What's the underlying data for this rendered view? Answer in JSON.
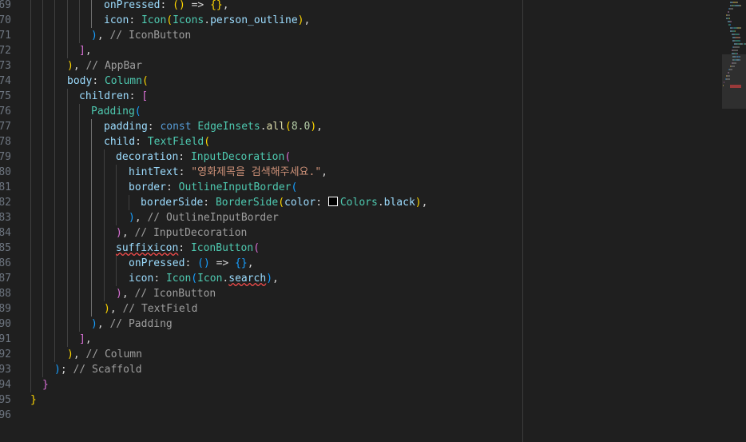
{
  "line_numbers": [
    "69",
    "70",
    "71",
    "72",
    "73",
    "74",
    "75",
    "76",
    "77",
    "78",
    "79",
    "80",
    "81",
    "82",
    "83",
    "84",
    "85",
    "86",
    "87",
    "88",
    "89",
    "90",
    "91",
    "92",
    "93",
    "94",
    "95",
    "96"
  ],
  "code_lines": [
    [
      {
        "t": "onPressed",
        "c": "prop"
      },
      {
        "t": ": ",
        "c": "punc"
      },
      {
        "t": "(",
        "c": "p1"
      },
      {
        "t": ")",
        "c": "p1"
      },
      {
        "t": " => ",
        "c": "punc"
      },
      {
        "t": "{",
        "c": "p1"
      },
      {
        "t": "}",
        "c": "p1"
      },
      {
        "t": ",",
        "c": "punc"
      }
    ],
    [
      {
        "t": "icon",
        "c": "prop"
      },
      {
        "t": ": ",
        "c": "punc"
      },
      {
        "t": "Icon",
        "c": "cls"
      },
      {
        "t": "(",
        "c": "p1"
      },
      {
        "t": "Icons",
        "c": "cls"
      },
      {
        "t": ".",
        "c": "punc"
      },
      {
        "t": "person_outline",
        "c": "prop"
      },
      {
        "t": ")",
        "c": "p1"
      },
      {
        "t": ",",
        "c": "punc"
      }
    ],
    [
      {
        "t": ")",
        "c": "p3"
      },
      {
        "t": ", ",
        "c": "punc"
      },
      {
        "t": "// IconButton",
        "c": "com"
      }
    ],
    [
      {
        "t": "]",
        "c": "p2"
      },
      {
        "t": ",",
        "c": "punc"
      }
    ],
    [
      {
        "t": ")",
        "c": "p1"
      },
      {
        "t": ", ",
        "c": "punc"
      },
      {
        "t": "// AppBar",
        "c": "com"
      }
    ],
    [
      {
        "t": "body",
        "c": "prop"
      },
      {
        "t": ": ",
        "c": "punc"
      },
      {
        "t": "Column",
        "c": "cls"
      },
      {
        "t": "(",
        "c": "p1"
      }
    ],
    [
      {
        "t": "children",
        "c": "prop"
      },
      {
        "t": ": ",
        "c": "punc"
      },
      {
        "t": "[",
        "c": "p2"
      }
    ],
    [
      {
        "t": "Padding",
        "c": "cls"
      },
      {
        "t": "(",
        "c": "p3"
      }
    ],
    [
      {
        "t": "padding",
        "c": "prop"
      },
      {
        "t": ": ",
        "c": "punc"
      },
      {
        "t": "const ",
        "c": "kw"
      },
      {
        "t": "EdgeInsets",
        "c": "cls"
      },
      {
        "t": ".",
        "c": "punc"
      },
      {
        "t": "all",
        "c": "fn"
      },
      {
        "t": "(",
        "c": "p1"
      },
      {
        "t": "8.0",
        "c": "num"
      },
      {
        "t": ")",
        "c": "p1"
      },
      {
        "t": ",",
        "c": "punc"
      }
    ],
    [
      {
        "t": "child",
        "c": "prop"
      },
      {
        "t": ": ",
        "c": "punc"
      },
      {
        "t": "TextField",
        "c": "cls"
      },
      {
        "t": "(",
        "c": "p1"
      }
    ],
    [
      {
        "t": "decoration",
        "c": "prop"
      },
      {
        "t": ": ",
        "c": "punc"
      },
      {
        "t": "InputDecoration",
        "c": "cls"
      },
      {
        "t": "(",
        "c": "p2"
      }
    ],
    [
      {
        "t": "hintText",
        "c": "prop"
      },
      {
        "t": ": ",
        "c": "punc"
      },
      {
        "t": "\"영화제목을 검색해주세요.\"",
        "c": "str"
      },
      {
        "t": ",",
        "c": "punc"
      }
    ],
    [
      {
        "t": "border",
        "c": "prop"
      },
      {
        "t": ": ",
        "c": "punc"
      },
      {
        "t": "OutlineInputBorder",
        "c": "cls"
      },
      {
        "t": "(",
        "c": "p3"
      }
    ],
    [
      {
        "t": "borderSide",
        "c": "prop"
      },
      {
        "t": ": ",
        "c": "punc"
      },
      {
        "t": "BorderSide",
        "c": "cls"
      },
      {
        "t": "(",
        "c": "p1"
      },
      {
        "t": "color",
        "c": "prop"
      },
      {
        "t": ": ",
        "c": "punc"
      },
      {
        "t": "",
        "c": "swatch"
      },
      {
        "t": "Colors",
        "c": "cls"
      },
      {
        "t": ".",
        "c": "punc"
      },
      {
        "t": "black",
        "c": "prop"
      },
      {
        "t": ")",
        "c": "p1"
      },
      {
        "t": ",",
        "c": "punc"
      }
    ],
    [
      {
        "t": ")",
        "c": "p3"
      },
      {
        "t": ", ",
        "c": "punc"
      },
      {
        "t": "// OutlineInputBorder",
        "c": "com"
      }
    ],
    [
      {
        "t": ")",
        "c": "p2"
      },
      {
        "t": ", ",
        "c": "punc"
      },
      {
        "t": "// InputDecoration",
        "c": "com"
      }
    ],
    [
      {
        "t": "suffixicon",
        "c": "prop squig"
      },
      {
        "t": ": ",
        "c": "punc"
      },
      {
        "t": "IconButton",
        "c": "cls"
      },
      {
        "t": "(",
        "c": "p2"
      }
    ],
    [
      {
        "t": "onPressed",
        "c": "prop"
      },
      {
        "t": ": ",
        "c": "punc"
      },
      {
        "t": "(",
        "c": "p3"
      },
      {
        "t": ")",
        "c": "p3"
      },
      {
        "t": " => ",
        "c": "punc"
      },
      {
        "t": "{",
        "c": "p3"
      },
      {
        "t": "}",
        "c": "p3"
      },
      {
        "t": ",",
        "c": "punc"
      }
    ],
    [
      {
        "t": "icon",
        "c": "prop"
      },
      {
        "t": ": ",
        "c": "punc"
      },
      {
        "t": "Icon",
        "c": "cls"
      },
      {
        "t": "(",
        "c": "p3"
      },
      {
        "t": "Icon",
        "c": "cls"
      },
      {
        "t": ".",
        "c": "punc"
      },
      {
        "t": "search",
        "c": "prop squig"
      },
      {
        "t": ")",
        "c": "p3"
      },
      {
        "t": ",",
        "c": "punc"
      }
    ],
    [
      {
        "t": ")",
        "c": "p2"
      },
      {
        "t": ", ",
        "c": "punc"
      },
      {
        "t": "// IconButton",
        "c": "com"
      }
    ],
    [
      {
        "t": ")",
        "c": "p1"
      },
      {
        "t": ", ",
        "c": "punc"
      },
      {
        "t": "// TextField",
        "c": "com"
      }
    ],
    [
      {
        "t": ")",
        "c": "p3"
      },
      {
        "t": ", ",
        "c": "punc"
      },
      {
        "t": "// Padding",
        "c": "com"
      }
    ],
    [
      {
        "t": "]",
        "c": "p2"
      },
      {
        "t": ",",
        "c": "punc"
      }
    ],
    [
      {
        "t": ")",
        "c": "p1"
      },
      {
        "t": ", ",
        "c": "punc"
      },
      {
        "t": "// Column",
        "c": "com"
      }
    ],
    [
      {
        "t": ")",
        "c": "p3"
      },
      {
        "t": "; ",
        "c": "punc"
      },
      {
        "t": "// Scaffold",
        "c": "com"
      }
    ],
    [
      {
        "t": "}",
        "c": "p2"
      }
    ],
    [
      {
        "t": "}",
        "c": "p1"
      }
    ],
    []
  ],
  "colors": {
    "background": "#1f1f1f",
    "line_number": "#6e7681",
    "keyword": "#569cd6",
    "class": "#4ec9b0",
    "property": "#9cdcfe",
    "function": "#dcdcaa",
    "string": "#ce9178",
    "number": "#b5cea8",
    "comment": "#9e9e9e",
    "bracket_1": "#ffd700",
    "bracket_2": "#da70d6",
    "bracket_3": "#179fff",
    "error_squiggle": "#f14c4c"
  }
}
